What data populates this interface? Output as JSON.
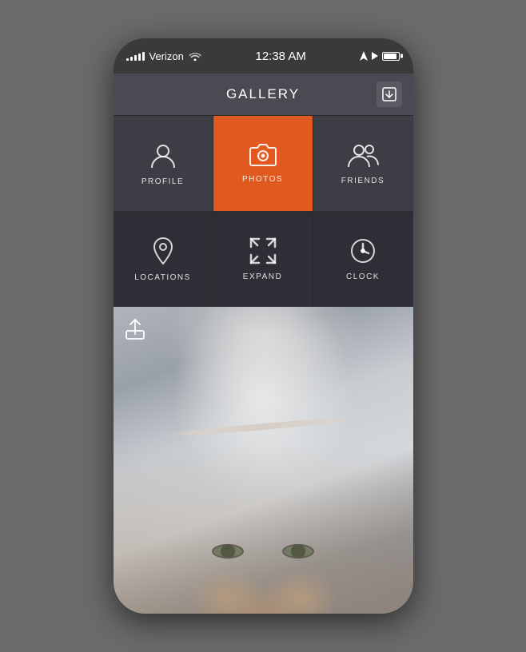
{
  "statusBar": {
    "carrier": "Verizon",
    "time": "12:38 AM",
    "signalBars": [
      3,
      5,
      7,
      9,
      11
    ],
    "wifiLabel": "wifi",
    "arrowLabel": "navigation",
    "playLabel": "play",
    "batteryLabel": "battery"
  },
  "header": {
    "title": "GALLERY",
    "exportIconLabel": "export"
  },
  "gridTop": [
    {
      "id": "profile",
      "label": "PROFILE",
      "icon": "profile",
      "active": false
    },
    {
      "id": "photos",
      "label": "PHOTOS",
      "icon": "camera",
      "active": true
    },
    {
      "id": "friends",
      "label": "FRIENDS",
      "icon": "friends",
      "active": false
    }
  ],
  "gridBottom": [
    {
      "id": "locations",
      "label": "LOCATIONS",
      "icon": "location",
      "active": false
    },
    {
      "id": "expand",
      "label": "EXPAND",
      "icon": "expand",
      "active": false
    },
    {
      "id": "clock",
      "label": "CLOCK",
      "icon": "clock",
      "active": false
    }
  ],
  "photo": {
    "shareIconLabel": "share"
  }
}
